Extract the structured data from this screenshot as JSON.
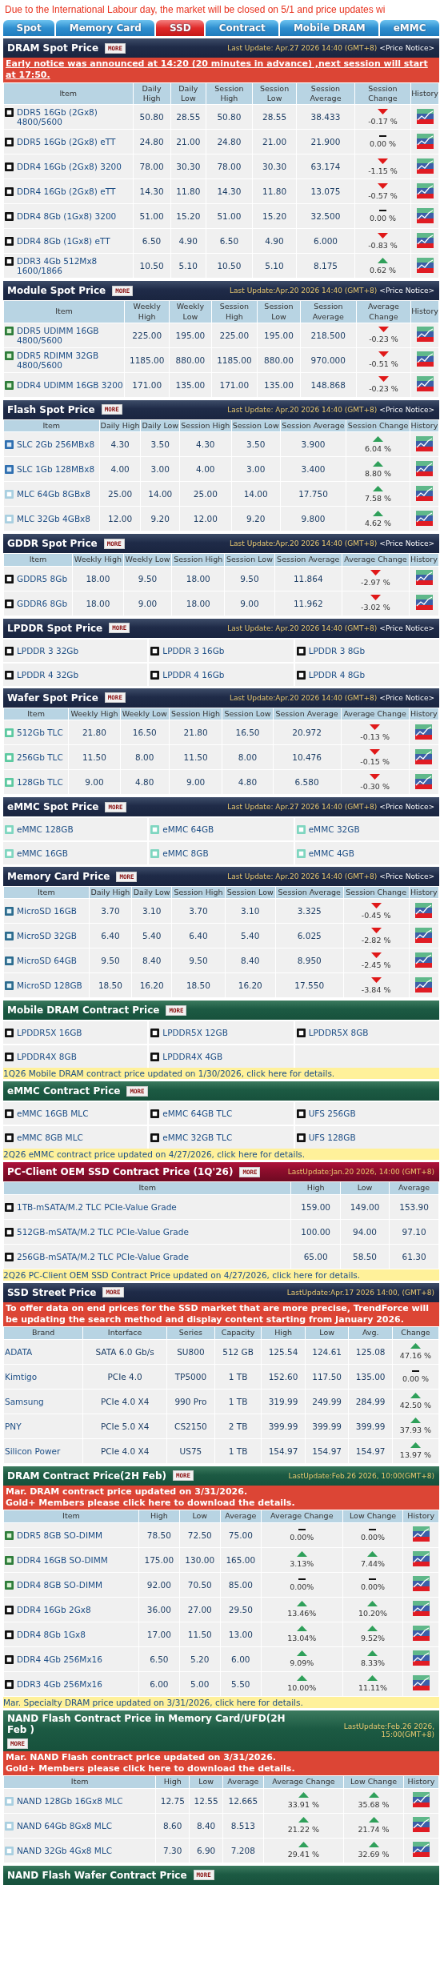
{
  "banner": "Due to the International Labour day, the market will be closed on 5/1 and price updates wi",
  "tabs": [
    {
      "label": "Spot",
      "selected": false
    },
    {
      "label": "Memory Card",
      "selected": false
    },
    {
      "label": "SSD",
      "selected": true
    },
    {
      "label": "Contract",
      "selected": false
    },
    {
      "label": "Mobile DRAM",
      "selected": false
    },
    {
      "label": "eMMC",
      "selected": false
    }
  ],
  "sections": [
    {
      "kind": "spot-table",
      "title": "DRAM Spot Price",
      "more": "MORE",
      "update": "Last Update: Apr.27 2026 14:40 (GMT+8)",
      "notice": "<Price Notice>",
      "alert": {
        "link": true,
        "lines": [
          "Early notice was announced at 14:20 (20 minutes in advance) ,next session will start at 17:50."
        ]
      },
      "columns": [
        "Item",
        "Daily High",
        "Daily Low",
        "Session High",
        "Session Low",
        "Session Average",
        "Session Change",
        "History"
      ],
      "rows": [
        {
          "kind": "chip",
          "cells": [
            "DDR5 16Gb (2Gx8) 4800/5600",
            "50.80",
            "28.55",
            "50.80",
            "28.55",
            "38.433"
          ],
          "changes": [
            {
              "kind": "down",
              "text": "-0.17 %"
            }
          ],
          "history": true
        },
        {
          "kind": "chip",
          "cells": [
            "DDR5 16Gb (2Gx8) eTT",
            "24.80",
            "21.00",
            "24.80",
            "21.00",
            "21.900"
          ],
          "changes": [
            {
              "kind": "flat",
              "text": "0.00 %"
            }
          ],
          "history": true
        },
        {
          "kind": "chip",
          "cells": [
            "DDR4 16Gb (2Gx8) 3200",
            "78.00",
            "30.30",
            "78.00",
            "30.30",
            "63.174"
          ],
          "changes": [
            {
              "kind": "down",
              "text": "-1.15 %"
            }
          ],
          "history": true
        },
        {
          "kind": "chip",
          "cells": [
            "DDR4 16Gb (2Gx8) eTT",
            "14.30",
            "11.80",
            "14.30",
            "11.80",
            "13.075"
          ],
          "changes": [
            {
              "kind": "down",
              "text": "-0.57 %"
            }
          ],
          "history": true
        },
        {
          "kind": "chip",
          "cells": [
            "DDR4 8Gb (1Gx8) 3200",
            "51.00",
            "15.20",
            "51.00",
            "15.20",
            "32.500"
          ],
          "changes": [
            {
              "kind": "flat",
              "text": "0.00 %"
            }
          ],
          "history": true
        },
        {
          "kind": "chip",
          "cells": [
            "DDR4 8Gb (1Gx8) eTT",
            "6.50",
            "4.90",
            "6.50",
            "4.90",
            "6.000"
          ],
          "changes": [
            {
              "kind": "down",
              "text": "-0.83 %"
            }
          ],
          "history": true
        },
        {
          "kind": "chip",
          "cells": [
            "DDR3 4Gb 512Mx8 1600/1866",
            "10.50",
            "5.10",
            "10.50",
            "5.10",
            "8.175"
          ],
          "changes": [
            {
              "kind": "up",
              "text": "0.62 %"
            }
          ],
          "history": true
        }
      ]
    },
    {
      "kind": "spot-table",
      "title": "Module Spot Price",
      "more": "MORE",
      "update": "Last Update:Apr.20 2026 14:40 (GMT+8)",
      "notice": "<Price Notice>",
      "columns": [
        "Item",
        "Weekly High",
        "Weekly Low",
        "Session High",
        "Session Low",
        "Session Average",
        "Average Change",
        "History"
      ],
      "rows": [
        {
          "kind": "module",
          "cells": [
            "DDR5 UDIMM 16GB 4800/5600",
            "225.00",
            "195.00",
            "225.00",
            "195.00",
            "218.500"
          ],
          "changes": [
            {
              "kind": "down",
              "text": "-0.23 %"
            }
          ],
          "history": true
        },
        {
          "kind": "module",
          "cells": [
            "DDR5 RDIMM 32GB 4800/5600",
            "1185.00",
            "880.00",
            "1185.00",
            "880.00",
            "970.000"
          ],
          "changes": [
            {
              "kind": "down",
              "text": "-0.51 %"
            }
          ],
          "history": true
        },
        {
          "kind": "module",
          "cells": [
            "DDR4 UDIMM 16GB 3200",
            "171.00",
            "135.00",
            "171.00",
            "135.00",
            "148.868"
          ],
          "changes": [
            {
              "kind": "down",
              "text": "-0.23 %"
            }
          ],
          "history": true
        }
      ]
    },
    {
      "kind": "spot-table",
      "title": "Flash Spot Price",
      "more": "MORE",
      "update": "Last Update: Apr.20 2026 14:40 (GMT+8)",
      "notice": "<Price Notice>",
      "columns": [
        "Item",
        "Daily High",
        "Daily Low",
        "Session High",
        "Session Low",
        "Session Average",
        "Session Change",
        "History"
      ],
      "rows": [
        {
          "kind": "slc",
          "cells": [
            "SLC 2Gb 256MBx8",
            "4.30",
            "3.50",
            "4.30",
            "3.50",
            "3.900"
          ],
          "changes": [
            {
              "kind": "up",
              "text": "6.04 %"
            }
          ],
          "history": true
        },
        {
          "kind": "slc",
          "cells": [
            "SLC 1Gb 128MBx8",
            "4.00",
            "3.00",
            "4.00",
            "3.00",
            "3.400"
          ],
          "changes": [
            {
              "kind": "up",
              "text": "8.80 %"
            }
          ],
          "history": true
        },
        {
          "kind": "mlc",
          "cells": [
            "MLC 64Gb 8GBx8",
            "25.00",
            "14.00",
            "25.00",
            "14.00",
            "17.750"
          ],
          "changes": [
            {
              "kind": "up",
              "text": "7.58 %"
            }
          ],
          "history": true
        },
        {
          "kind": "mlc",
          "cells": [
            "MLC 32Gb 4GBx8",
            "12.00",
            "9.20",
            "12.00",
            "9.20",
            "9.800"
          ],
          "changes": [
            {
              "kind": "up",
              "text": "4.62 %"
            }
          ],
          "history": true
        }
      ]
    },
    {
      "kind": "spot-table",
      "title": "GDDR Spot Price",
      "more": "MORE",
      "update": "Last Update:Apr.20 2026 14:40 (GMT+8)",
      "notice": "<Price Notice>",
      "columns": [
        "Item",
        "Weekly High",
        "Weekly Low",
        "Session High",
        "Session Low",
        "Session Average",
        "Average Change",
        "History"
      ],
      "rows": [
        {
          "kind": "chip",
          "cells": [
            "GDDR5 8Gb",
            "18.00",
            "9.50",
            "18.00",
            "9.50",
            "11.864"
          ],
          "changes": [
            {
              "kind": "down",
              "text": "-2.97 %"
            }
          ],
          "history": true
        },
        {
          "kind": "chip",
          "cells": [
            "GDDR6 8Gb",
            "18.00",
            "9.00",
            "18.00",
            "9.00",
            "11.962"
          ],
          "changes": [
            {
              "kind": "down",
              "text": "-3.02 %"
            }
          ],
          "history": true
        }
      ]
    },
    {
      "kind": "spot-grid",
      "title": "LPDDR Spot Price",
      "more": "MORE",
      "update": "Last Update: Apr.20 2026 14:40 (GMT+8)",
      "notice": "<Price Notice>",
      "items": [
        {
          "kind": "chip",
          "label": "LPDDR 3 32Gb"
        },
        {
          "kind": "chip",
          "label": "LPDDR 3 16Gb"
        },
        {
          "kind": "chip",
          "label": "LPDDR 3 8Gb"
        },
        {
          "kind": "chip",
          "label": "LPDDR 4 32Gb"
        },
        {
          "kind": "chip",
          "label": "LPDDR 4 16Gb"
        },
        {
          "kind": "chip",
          "label": "LPDDR 4 8Gb"
        }
      ]
    },
    {
      "kind": "spot-table",
      "title": "Wafer Spot Price",
      "more": "MORE",
      "update": "Last Update:Apr.20 2026 14:40 (GMT+8)",
      "notice": "<Price Notice>",
      "columns": [
        "Item",
        "Weekly High",
        "Weekly Low",
        "Session High",
        "Session Low",
        "Session Average",
        "Average Change",
        "History"
      ],
      "rows": [
        {
          "kind": "tlc",
          "cells": [
            "512Gb TLC",
            "21.80",
            "16.50",
            "21.80",
            "16.50",
            "20.972"
          ],
          "changes": [
            {
              "kind": "down",
              "text": "-0.13 %"
            }
          ],
          "history": true
        },
        {
          "kind": "tlc",
          "cells": [
            "256Gb TLC",
            "11.50",
            "8.00",
            "11.50",
            "8.00",
            "10.476"
          ],
          "changes": [
            {
              "kind": "down",
              "text": "-0.15 %"
            }
          ],
          "history": true
        },
        {
          "kind": "tlc",
          "cells": [
            "128Gb TLC",
            "9.00",
            "4.80",
            "9.00",
            "4.80",
            "6.580"
          ],
          "changes": [
            {
              "kind": "down",
              "text": "-0.30 %"
            }
          ],
          "history": true
        }
      ]
    },
    {
      "kind": "spot-grid",
      "title": "eMMC Spot Price",
      "more": "MORE",
      "update": "Last Update: Apr.27 2026 14:40 (GMT+8)",
      "notice": "<Price Notice>",
      "items": [
        {
          "kind": "emmc",
          "label": "eMMC 128GB"
        },
        {
          "kind": "emmc",
          "label": "eMMC 64GB"
        },
        {
          "kind": "emmc",
          "label": "eMMC 32GB"
        },
        {
          "kind": "emmc",
          "label": "eMMC 16GB"
        },
        {
          "kind": "emmc",
          "label": "eMMC 8GB"
        },
        {
          "kind": "emmc",
          "label": "eMMC 4GB"
        }
      ]
    },
    {
      "kind": "spot-table",
      "title": "Memory Card Price",
      "more": "MORE",
      "update": "Last Update: Apr.20 2026 14:40 (GMT+8)",
      "notice": "<Price Notice>",
      "columns": [
        "Item",
        "Daily High",
        "Daily Low",
        "Session High",
        "Session Low",
        "Session Average",
        "Session Change",
        "History"
      ],
      "rows": [
        {
          "kind": "card",
          "cells": [
            "MicroSD 16GB",
            "3.70",
            "3.10",
            "3.70",
            "3.10",
            "3.325"
          ],
          "changes": [
            {
              "kind": "down",
              "text": "-0.45 %"
            }
          ],
          "history": true
        },
        {
          "kind": "card",
          "cells": [
            "MicroSD 32GB",
            "6.40",
            "5.40",
            "6.40",
            "5.40",
            "6.025"
          ],
          "changes": [
            {
              "kind": "down",
              "text": "-2.82 %"
            }
          ],
          "history": true
        },
        {
          "kind": "card",
          "cells": [
            "MicroSD 64GB",
            "9.50",
            "8.40",
            "9.50",
            "8.40",
            "8.950"
          ],
          "changes": [
            {
              "kind": "down",
              "text": "-2.45 %"
            }
          ],
          "history": true
        },
        {
          "kind": "card",
          "cells": [
            "MicroSD 128GB",
            "18.50",
            "16.20",
            "18.50",
            "16.20",
            "17.550"
          ],
          "changes": [
            {
              "kind": "down",
              "text": "-3.84 %"
            }
          ],
          "history": true
        }
      ]
    },
    {
      "kind": "contract-grid",
      "title": "Mobile DRAM Contract Price",
      "more": "MORE",
      "items": [
        {
          "kind": "chip",
          "label": "LPDDR5X 16GB"
        },
        {
          "kind": "chip",
          "label": "LPDDR5X 12GB"
        },
        {
          "kind": "chip",
          "label": "LPDDR5X 8GB"
        },
        {
          "kind": "chip",
          "label": "LPDDR4X 8GB"
        },
        {
          "kind": "chip",
          "label": "LPDDR4X 4GB"
        }
      ],
      "footnote": "1Q26 Mobile DRAM contract price updated on 1/30/2026, click here for details."
    },
    {
      "kind": "contract-grid",
      "title": "eMMC Contract Price",
      "more": "MORE",
      "items": [
        {
          "kind": "chip",
          "label": "eMMC 16GB MLC"
        },
        {
          "kind": "chip",
          "label": "eMMC 64GB TLC"
        },
        {
          "kind": "chip",
          "label": "UFS 256GB"
        },
        {
          "kind": "chip",
          "label": "eMMC 8GB MLC"
        },
        {
          "kind": "chip",
          "label": "eMMC 32GB TLC"
        },
        {
          "kind": "chip",
          "label": "UFS 128GB"
        }
      ],
      "footnote": "2Q26 eMMC contract price updated on 4/27/2026, click here for details."
    },
    {
      "kind": "oem-table",
      "title": "PC-Client OEM SSD Contract Price (1Q'26)",
      "more": "MORE",
      "update": "LastUpdate:Jan.20 2026, 14:00 (GMT+8)",
      "columns": [
        "Item",
        "High",
        "Low",
        "Average"
      ],
      "rows": [
        {
          "kind": "chip",
          "cells": [
            "1TB-mSATA/M.2 TLC PCIe-Value Grade",
            "159.00",
            "149.00",
            "153.90"
          ]
        },
        {
          "kind": "chip",
          "cells": [
            "512GB-mSATA/M.2 TLC PCIe-Value Grade",
            "100.00",
            "94.00",
            "97.10"
          ]
        },
        {
          "kind": "chip",
          "cells": [
            "256GB-mSATA/M.2 TLC PCIe-Value Grade",
            "65.00",
            "58.50",
            "61.30"
          ]
        }
      ],
      "footnote": "2Q26 PC-Client OEM SSD Contract Price updated on 4/27/2026, click here for details."
    },
    {
      "kind": "street-table",
      "title": "SSD Street Price",
      "more": "MORE",
      "update": "LastUpdate:Apr.17 2026 14:00, (GMT+8)",
      "alert": {
        "link": false,
        "lines": [
          "To offer data on end prices for the SSD market that are more precise, TrendForce will be updating the search method and display content starting from January 2026."
        ]
      },
      "columns": [
        "Brand",
        "Interface",
        "Series",
        "Capacity",
        "High",
        "Low",
        "Avg.",
        "Change"
      ],
      "rows": [
        {
          "cells": [
            "ADATA",
            "SATA 6.0 Gb/s",
            "SU800",
            "512 GB",
            "125.54",
            "124.61",
            "125.08"
          ],
          "changes": [
            {
              "kind": "up",
              "text": "47.16 %"
            }
          ]
        },
        {
          "cells": [
            "Kimtigo",
            "PCIe 4.0",
            "TP5000",
            "1 TB",
            "152.60",
            "117.50",
            "135.00"
          ],
          "changes": [
            {
              "kind": "flat",
              "text": "0.00 %"
            }
          ]
        },
        {
          "cells": [
            "Samsung",
            "PCIe 4.0 X4",
            "990 Pro",
            "1 TB",
            "319.99",
            "249.99",
            "284.99"
          ],
          "changes": [
            {
              "kind": "up",
              "text": "42.50 %"
            }
          ]
        },
        {
          "cells": [
            "PNY",
            "PCIe 5.0 X4",
            "CS2150",
            "2 TB",
            "399.99",
            "399.99",
            "399.99"
          ],
          "changes": [
            {
              "kind": "up",
              "text": "37.93 %"
            }
          ]
        },
        {
          "cells": [
            "Silicon Power",
            "PCIe 4.0 X4",
            "US75",
            "1 TB",
            "154.97",
            "154.97",
            "154.97"
          ],
          "changes": [
            {
              "kind": "up",
              "text": "13.97 %"
            }
          ]
        }
      ]
    },
    {
      "kind": "contract-table",
      "title": "DRAM Contract Price(2H Feb)",
      "more": "MORE",
      "update": "LastUpdate:Feb.26 2026, 10:00(GMT+8)",
      "alert": {
        "link": false,
        "lines": [
          "Mar. DRAM contract price updated on 3/31/2026.",
          "Gold+ Members please click here to download the details."
        ]
      },
      "columns": [
        "Item",
        "High",
        "Low",
        "Average",
        "Average Change",
        "Low Change",
        "History"
      ],
      "rows": [
        {
          "kind": "module",
          "cells": [
            "DDR5 8GB SO-DIMM",
            "78.50",
            "72.50",
            "75.00"
          ],
          "changes": [
            {
              "kind": "flat",
              "text": "0.00%"
            },
            {
              "kind": "flat",
              "text": "0.00%"
            }
          ],
          "history": true
        },
        {
          "kind": "module",
          "cells": [
            "DDR4 16GB SO-DIMM",
            "175.00",
            "130.00",
            "165.00"
          ],
          "changes": [
            {
              "kind": "up",
              "text": "3.13%"
            },
            {
              "kind": "up",
              "text": "7.44%"
            }
          ],
          "history": true
        },
        {
          "kind": "module",
          "cells": [
            "DDR4 8GB SO-DIMM",
            "92.00",
            "70.50",
            "85.00"
          ],
          "changes": [
            {
              "kind": "flat",
              "text": "0.00%"
            },
            {
              "kind": "flat",
              "text": "0.00%"
            }
          ],
          "history": true
        },
        {
          "kind": "chip",
          "cells": [
            "DDR4 16Gb 2Gx8",
            "36.00",
            "27.00",
            "29.50"
          ],
          "changes": [
            {
              "kind": "up",
              "text": "13.46%"
            },
            {
              "kind": "up",
              "text": "10.20%"
            }
          ],
          "history": true
        },
        {
          "kind": "chip",
          "cells": [
            "DDR4 8Gb 1Gx8",
            "17.00",
            "11.50",
            "13.00"
          ],
          "changes": [
            {
              "kind": "up",
              "text": "13.04%"
            },
            {
              "kind": "up",
              "text": "9.52%"
            }
          ],
          "history": true
        },
        {
          "kind": "chip",
          "cells": [
            "DDR4 4Gb 256Mx16",
            "6.50",
            "5.20",
            "6.00"
          ],
          "changes": [
            {
              "kind": "up",
              "text": "9.09%"
            },
            {
              "kind": "up",
              "text": "8.33%"
            }
          ],
          "history": true
        },
        {
          "kind": "chip",
          "cells": [
            "DDR3 4Gb 256Mx16",
            "6.00",
            "5.00",
            "5.50"
          ],
          "changes": [
            {
              "kind": "up",
              "text": "10.00%"
            },
            {
              "kind": "up",
              "text": "11.11%"
            }
          ],
          "history": true
        }
      ],
      "footnote": "Mar. Specialty DRAM price updated on 3/31/2026, click here for details."
    },
    {
      "kind": "contract-table",
      "title": "NAND Flash Contract Price in Memory Card/UFD(2H Feb )",
      "more": "MORE",
      "update": "LastUpdate:Feb.26 2026, 15:00(GMT+8)",
      "alert": {
        "link": false,
        "lines": [
          "Mar. NAND Flash contract price updated on 3/31/2026.",
          "Gold+ Members please click here to download the details."
        ]
      },
      "columns": [
        "Item",
        "High",
        "Low",
        "Average",
        "Average Change",
        "Low Change",
        "History"
      ],
      "rows": [
        {
          "kind": "mlc",
          "cells": [
            "NAND 128Gb 16Gx8 MLC",
            "12.75",
            "12.55",
            "12.665"
          ],
          "changes": [
            {
              "kind": "up",
              "text": "33.91 %"
            },
            {
              "kind": "up",
              "text": "35.68 %"
            }
          ],
          "history": true
        },
        {
          "kind": "mlc",
          "cells": [
            "NAND 64Gb 8Gx8 MLC",
            "8.60",
            "8.40",
            "8.513"
          ],
          "changes": [
            {
              "kind": "up",
              "text": "21.22 %"
            },
            {
              "kind": "up",
              "text": "21.74 %"
            }
          ],
          "history": true
        },
        {
          "kind": "mlc",
          "cells": [
            "NAND 32Gb 4Gx8 MLC",
            "7.30",
            "6.90",
            "7.208"
          ],
          "changes": [
            {
              "kind": "up",
              "text": "29.41 %"
            },
            {
              "kind": "up",
              "text": "32.69 %"
            }
          ],
          "history": true
        }
      ]
    },
    {
      "kind": "contract-header",
      "title": "NAND Flash Wafer Contract Price",
      "more": "MORE"
    }
  ]
}
